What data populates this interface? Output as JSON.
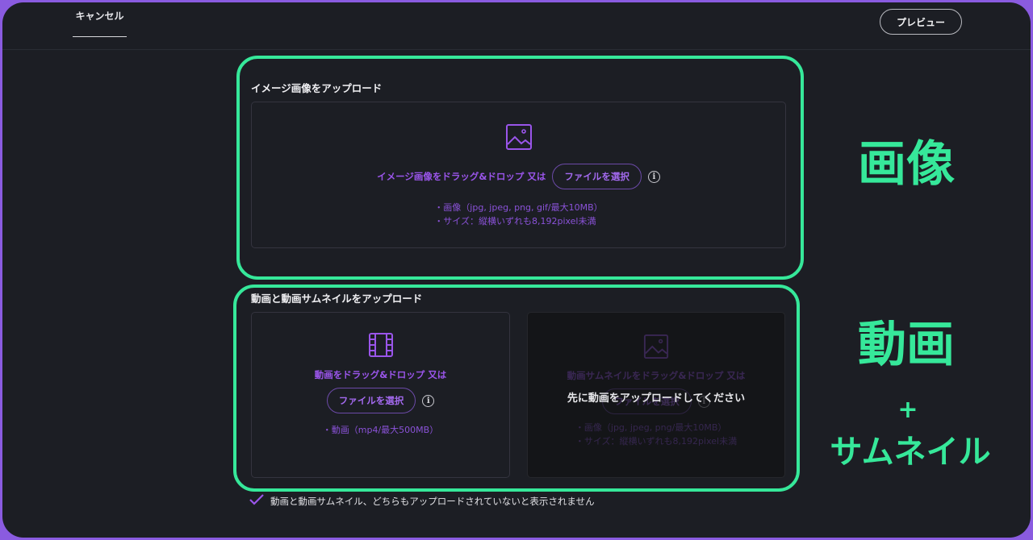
{
  "header": {
    "cancel_label": "キャンセル",
    "preview_label": "プレビュー"
  },
  "image_section": {
    "title": "イメージ画像をアップロード",
    "drop_text": "イメージ画像をドラッグ&ドロップ 又は",
    "file_button": "ファイルを選択",
    "spec_line1": "・画像（jpg, jpeg, png, gif/最大10MB）",
    "spec_line2": "・サイズ：縦横いずれも8,192pixel未満"
  },
  "video_section": {
    "title": "動画と動画サムネイルをアップロード",
    "video": {
      "drop_text": "動画をドラッグ&ドロップ 又は",
      "file_button": "ファイルを選択",
      "spec_line1": "・動画（mp4/最大500MB）"
    },
    "thumbnail": {
      "drop_text": "動画サムネイルをドラッグ&ドロップ 又は",
      "file_button": "ファイルを選択",
      "spec_line1": "・画像（jpg, jpeg, png/最大10MB）",
      "spec_line2": "・サイズ：縦横いずれも8,192pixel未満",
      "overlay_message": "先に動画をアップロードしてください"
    }
  },
  "checkbox": {
    "label": "動画と動画サムネイル、どちらもアップロードされていないと表示されません",
    "checked": true
  },
  "annotations": {
    "image_label": "画像",
    "video_label": "動画",
    "plus": "+",
    "thumbnail_label": "サムネイル"
  },
  "colors": {
    "accent_purple": "#9a55ea",
    "highlight_green": "#36e89a",
    "background": "#1c1e24",
    "outer_border": "#8a5be0"
  }
}
